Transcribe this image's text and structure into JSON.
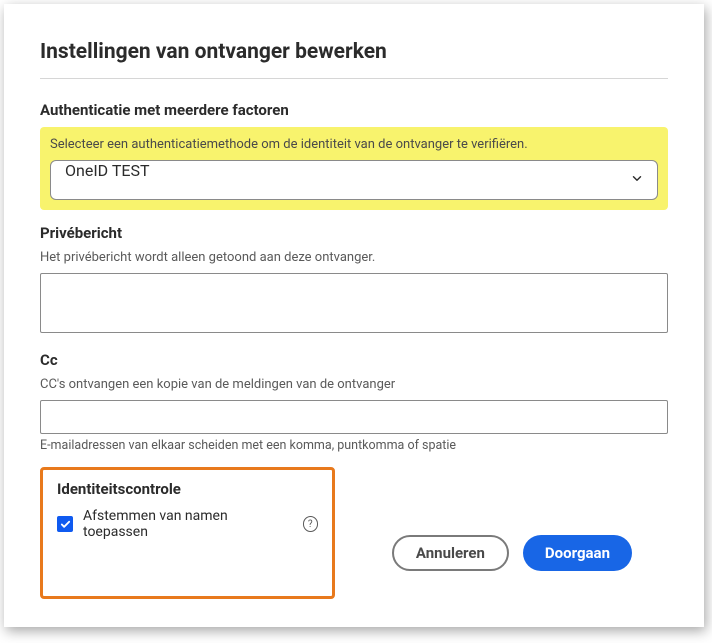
{
  "title": "Instellingen van ontvanger bewerken",
  "auth": {
    "section_title": "Authenticatie met meerdere factoren",
    "helper": "Selecteer een authenticatiemethode om de identiteit van de ontvanger te verifiëren.",
    "selected": "OneID TEST"
  },
  "private_message": {
    "section_title": "Privébericht",
    "helper": "Het privébericht wordt alleen getoond aan deze ontvanger.",
    "value": ""
  },
  "cc": {
    "section_title": "Cc",
    "helper": "CC's ontvangen een kopie van de meldingen van de ontvanger",
    "value": "",
    "hint": "E-mailadressen van elkaar scheiden met een komma, puntkomma of spatie"
  },
  "identity": {
    "section_title": "Identiteitscontrole",
    "checkbox_label": "Afstemmen van namen toepassen",
    "checked": true
  },
  "buttons": {
    "cancel": "Annuleren",
    "continue": "Doorgaan"
  }
}
